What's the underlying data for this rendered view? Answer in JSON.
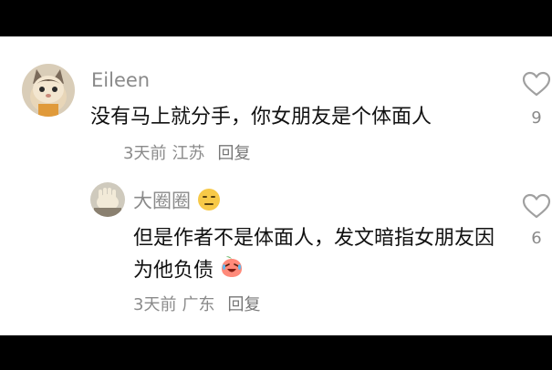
{
  "comments": [
    {
      "author": "Eileen",
      "text": "没有马上就分手，你女朋友是个体面人",
      "time": "3天前",
      "location": "江苏",
      "reply_label": "回复",
      "likes": "9",
      "avatar_icon": "cat-avatar"
    },
    {
      "author": "大圈圈",
      "author_emoji": "expressionless-face-emoji",
      "text": "但是作者不是体面人，发文暗指女朋友因为他负债",
      "text_emoji": "crying-laughing-peach-emoji",
      "time": "3天前",
      "location": "广东",
      "reply_label": "回复",
      "likes": "6",
      "avatar_icon": "hand-avatar"
    }
  ],
  "colors": {
    "letterbox": "#000000",
    "background": "#ffffff",
    "primary_text": "#111111",
    "secondary_text": "#8a8a8a",
    "emoji_yellow": "#f7c948",
    "emoji_peach": "#ff8a7a"
  }
}
